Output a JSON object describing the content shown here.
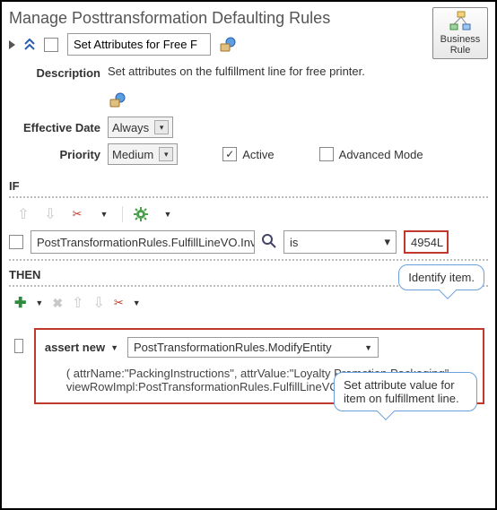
{
  "page": {
    "title": "Manage Posttransformation Defaulting Rules"
  },
  "businessRule": {
    "line1": "Business",
    "line2": "Rule"
  },
  "header": {
    "ruleName": "Set Attributes for Free F",
    "descriptionLabel": "Description",
    "description": "Set attributes on the fulfillment line for free printer.",
    "effectiveDateLabel": "Effective Date",
    "effectiveDate": "Always",
    "priorityLabel": "Priority",
    "priority": "Medium",
    "activeLabel": "Active",
    "activeChecked": "✓",
    "advancedLabel": "Advanced Mode"
  },
  "ifSection": {
    "label": "IF",
    "condition": {
      "lhs": "PostTransformationRules.FulfillLineVO.Inve",
      "op": "is",
      "rhs": "4954L"
    },
    "callout": "Identify item."
  },
  "thenSection": {
    "label": "THEN",
    "callout": "Set attribute value for item on fulfillment line.",
    "assertLabel": "assert new",
    "entity": "PostTransformationRules.ModifyEntity",
    "params": "( attrName:\"PackingInstructions\", attrValue:\"Loyalty Promotion Packaging\", viewRowImpl:PostTransformationRules.FulfillLineVO.ViewRowImpl )"
  }
}
